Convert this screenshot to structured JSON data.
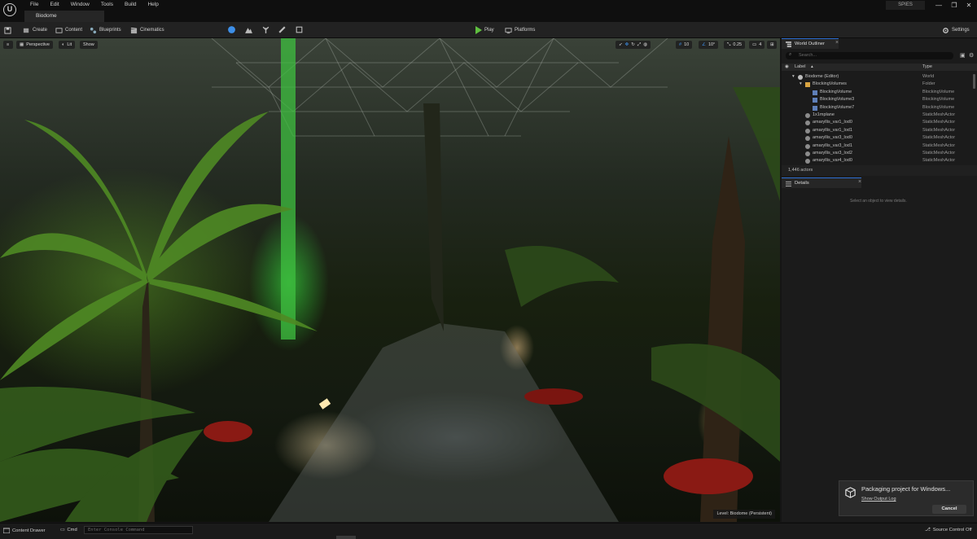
{
  "app": {
    "logo": "U",
    "menu": [
      "File",
      "Edit",
      "Window",
      "Tools",
      "Build",
      "Help"
    ],
    "level_tab": "Biodome",
    "project_badge": "SPIES",
    "window_controls": {
      "minimize": "—",
      "restore": "❐",
      "close": "✕"
    }
  },
  "toolbar": {
    "save_icon": "save-icon",
    "create": "Create",
    "content": "Content",
    "blueprints": "Blueprints",
    "cinematics": "Cinematics",
    "play": "Play",
    "platforms": "Platforms",
    "settings": "Settings"
  },
  "viewport": {
    "perspective": "Perspective",
    "lit": "Lit",
    "show": "Show",
    "grid_snap": "10",
    "rotation_snap": "10°",
    "scale_snap": "0.25",
    "camera_speed": "4",
    "level_label": "Level:  Biodome (Persistent)"
  },
  "outliner": {
    "tab": "World Outliner",
    "search_placeholder": "Search...",
    "col_label": "Label",
    "col_type": "Type",
    "rows": [
      {
        "label": "Biodome (Editor)",
        "type": "World",
        "indent": 0
      },
      {
        "label": "BlockingVolumes",
        "type": "Folder",
        "indent": 1
      },
      {
        "label": "BlockingVolume",
        "type": "BlockingVolume",
        "indent": 2
      },
      {
        "label": "BlockingVolume3",
        "type": "BlockingVolume",
        "indent": 2
      },
      {
        "label": "BlockingVolume7",
        "type": "BlockingVolume",
        "indent": 2
      },
      {
        "label": "1x1mplane",
        "type": "StaticMeshActor",
        "indent": 1
      },
      {
        "label": "amaryllis_var1_lod0",
        "type": "StaticMeshActor",
        "indent": 1
      },
      {
        "label": "amaryllis_var1_lod1",
        "type": "StaticMeshActor",
        "indent": 1
      },
      {
        "label": "amaryllis_var3_lod0",
        "type": "StaticMeshActor",
        "indent": 1
      },
      {
        "label": "amaryllis_var3_lod1",
        "type": "StaticMeshActor",
        "indent": 1
      },
      {
        "label": "amaryllis_var3_lod2",
        "type": "StaticMeshActor",
        "indent": 1
      },
      {
        "label": "amaryllis_var4_lod0",
        "type": "StaticMeshActor",
        "indent": 1
      }
    ],
    "actor_count": "1,446 actors"
  },
  "details": {
    "tab": "Details",
    "hint": "Select an object to view details."
  },
  "toast": {
    "title": "Packaging project for Windows...",
    "link": "Show Output Log",
    "cancel": "Cancel"
  },
  "statusbar": {
    "content_drawer": "Content Drawer",
    "cmd": "Cmd",
    "console_placeholder": "Enter Console Command",
    "source_control": "Source Control Off"
  },
  "colors": {
    "accent_blue": "#2e6fd3",
    "play_green": "#5fbf3f",
    "folder": "#d9a441"
  }
}
